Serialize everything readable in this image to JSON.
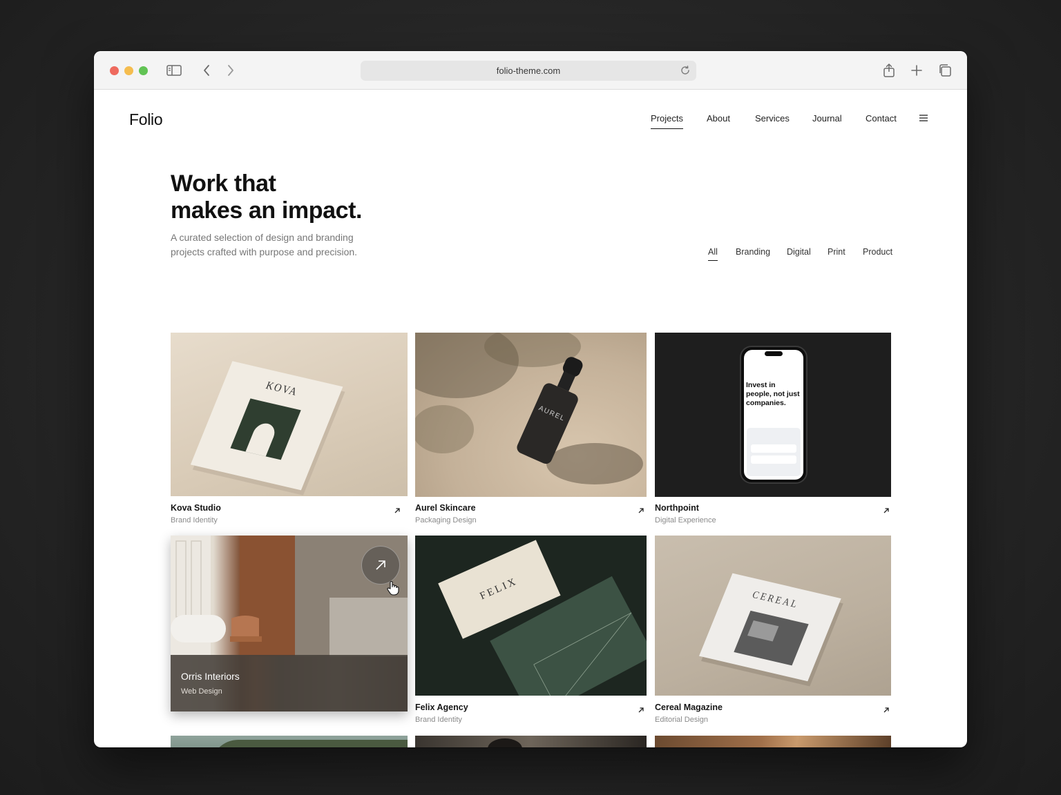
{
  "browser": {
    "url": "folio-theme.com"
  },
  "site": {
    "logo": "Folio",
    "nav": [
      {
        "label": "Projects",
        "active": true
      },
      {
        "label": "About"
      },
      {
        "label": "Services"
      },
      {
        "label": "Journal"
      },
      {
        "label": "Contact"
      }
    ]
  },
  "hero": {
    "title_line1": "Work that",
    "title_line2": "makes an impact.",
    "subtitle": "A curated selection of design and branding projects crafted with purpose and precision."
  },
  "filters": [
    {
      "label": "All",
      "active": true
    },
    {
      "label": "Branding"
    },
    {
      "label": "Digital"
    },
    {
      "label": "Print"
    },
    {
      "label": "Product"
    }
  ],
  "projects": [
    {
      "title": "Kova Studio",
      "category": "Brand Identity",
      "image_text": "KOVA"
    },
    {
      "title": "Aurel Skincare",
      "category": "Packaging Design",
      "image_text": "AUREL"
    },
    {
      "title": "Northpoint",
      "category": "Digital Experience",
      "image_text": "Invest in people, not just companies."
    },
    {
      "title": "Orris Interiors",
      "category": "Web Design",
      "hovered": true
    },
    {
      "title": "Felix Agency",
      "category": "Brand Identity",
      "image_text": "FELIX"
    },
    {
      "title": "Cereal Magazine",
      "category": "Editorial Design",
      "image_text": "CEREAL"
    }
  ],
  "colors": {
    "accent_text": "#111111",
    "muted_text": "#8a8a8a",
    "felix_green": "#2c3a31"
  }
}
